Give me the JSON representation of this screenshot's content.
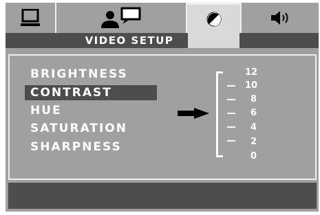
{
  "header": {
    "title": "VIDEO SETUP",
    "tabs": [
      {
        "name": "monitor",
        "icon": "monitor-icon",
        "active": false
      },
      {
        "name": "language",
        "icon": "person-speech-icon",
        "active": false
      },
      {
        "name": "video",
        "icon": "contrast-icon",
        "active": true
      },
      {
        "name": "audio",
        "icon": "speaker-icon",
        "active": false
      }
    ]
  },
  "menu": {
    "items": [
      {
        "label": "BRIGHTNESS",
        "selected": false
      },
      {
        "label": "CONTRAST",
        "selected": true
      },
      {
        "label": "HUE",
        "selected": false
      },
      {
        "label": "SATURATION",
        "selected": false
      },
      {
        "label": "SHARPNESS",
        "selected": false
      }
    ]
  },
  "scale": {
    "values": [
      "12",
      "10",
      "8",
      "6",
      "4",
      "2",
      "0"
    ]
  },
  "colors": {
    "background": "#a0a0a0",
    "bar": "#4d4d4d",
    "highlight": "#d9d9d9",
    "text": "#ffffff"
  }
}
